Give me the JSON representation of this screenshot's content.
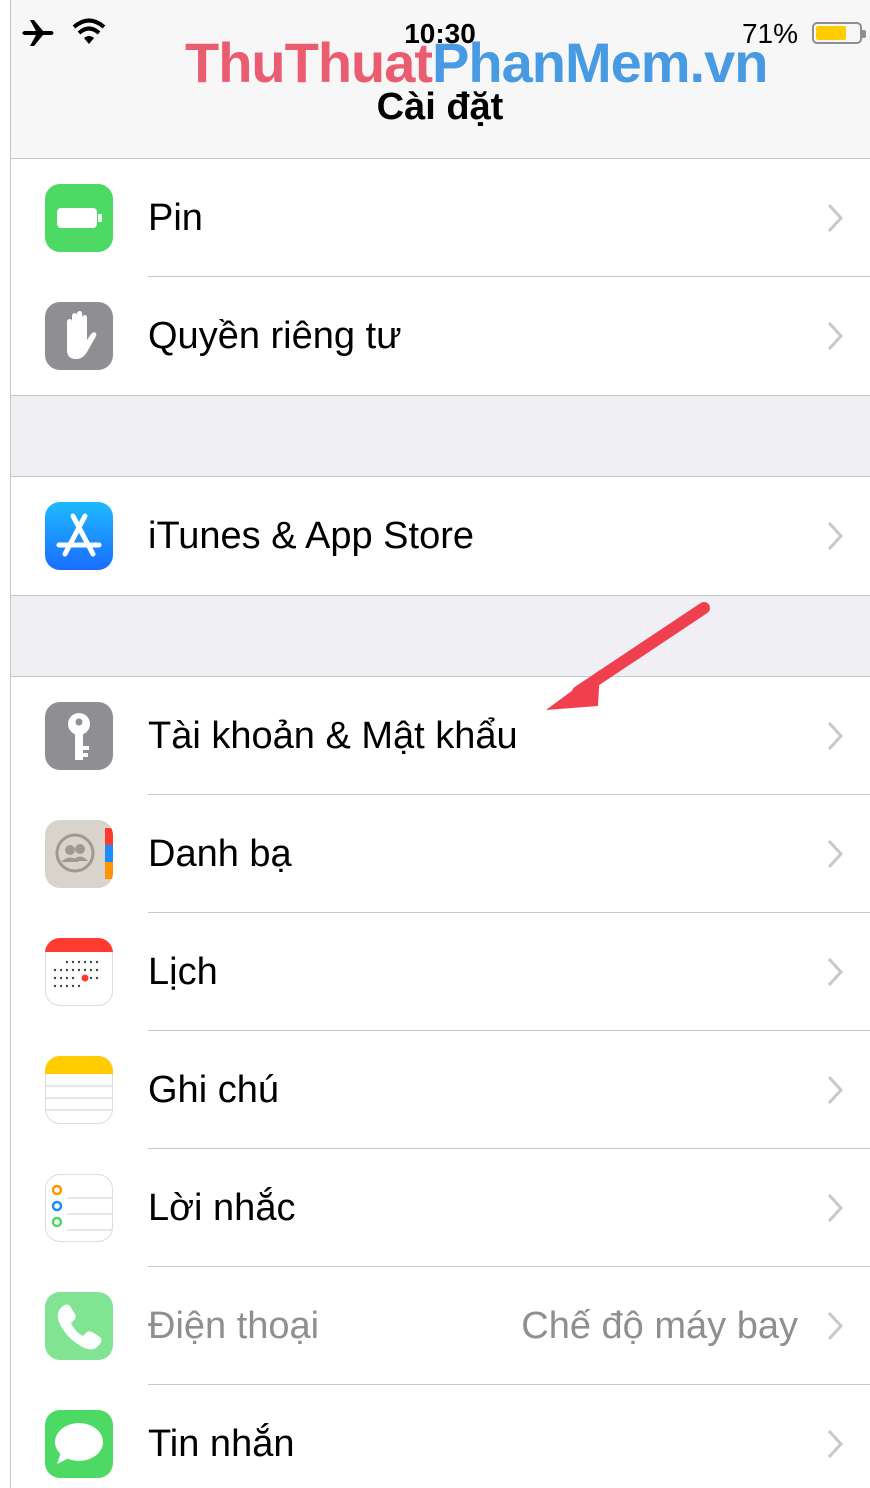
{
  "status_bar": {
    "time": "10:30",
    "battery_percent": "71%",
    "battery_level": 0.71,
    "icons": [
      "airplane-icon",
      "wifi-icon",
      "battery-icon"
    ]
  },
  "watermark": {
    "part1": "ThuThuat",
    "part2": "PhanMem.vn"
  },
  "nav": {
    "title": "Cài đặt"
  },
  "settings_groups": [
    {
      "items": [
        {
          "label": "Pin",
          "icon": "battery-app-icon",
          "color": "#4cd964"
        },
        {
          "label": "Quyền riêng tư",
          "icon": "privacy-hand-icon",
          "color": "#8e8e93"
        }
      ]
    },
    {
      "items": [
        {
          "label": "iTunes & App Store",
          "icon": "app-store-icon",
          "color": "#1a8cff"
        }
      ]
    },
    {
      "items": [
        {
          "label": "Tài khoản & Mật khẩu",
          "icon": "key-icon",
          "color": "#8e8e93"
        },
        {
          "label": "Danh bạ",
          "icon": "contacts-icon",
          "color": "#c8c4bb"
        },
        {
          "label": "Lịch",
          "icon": "calendar-icon",
          "color": "#ff3b30"
        },
        {
          "label": "Ghi chú",
          "icon": "notes-icon",
          "color": "#ffcc00"
        },
        {
          "label": "Lời nhắc",
          "icon": "reminders-icon",
          "color": "#ffffff"
        },
        {
          "label": "Điện thoại",
          "value": "Chế độ máy bay",
          "icon": "phone-icon",
          "color": "#4cd964",
          "dimmed": true
        },
        {
          "label": "Tin nhắn",
          "icon": "messages-icon",
          "color": "#4cd964"
        }
      ]
    }
  ],
  "annotation": {
    "type": "arrow",
    "color": "#f04050",
    "points_to": "Tài khoản & Mật khẩu"
  }
}
